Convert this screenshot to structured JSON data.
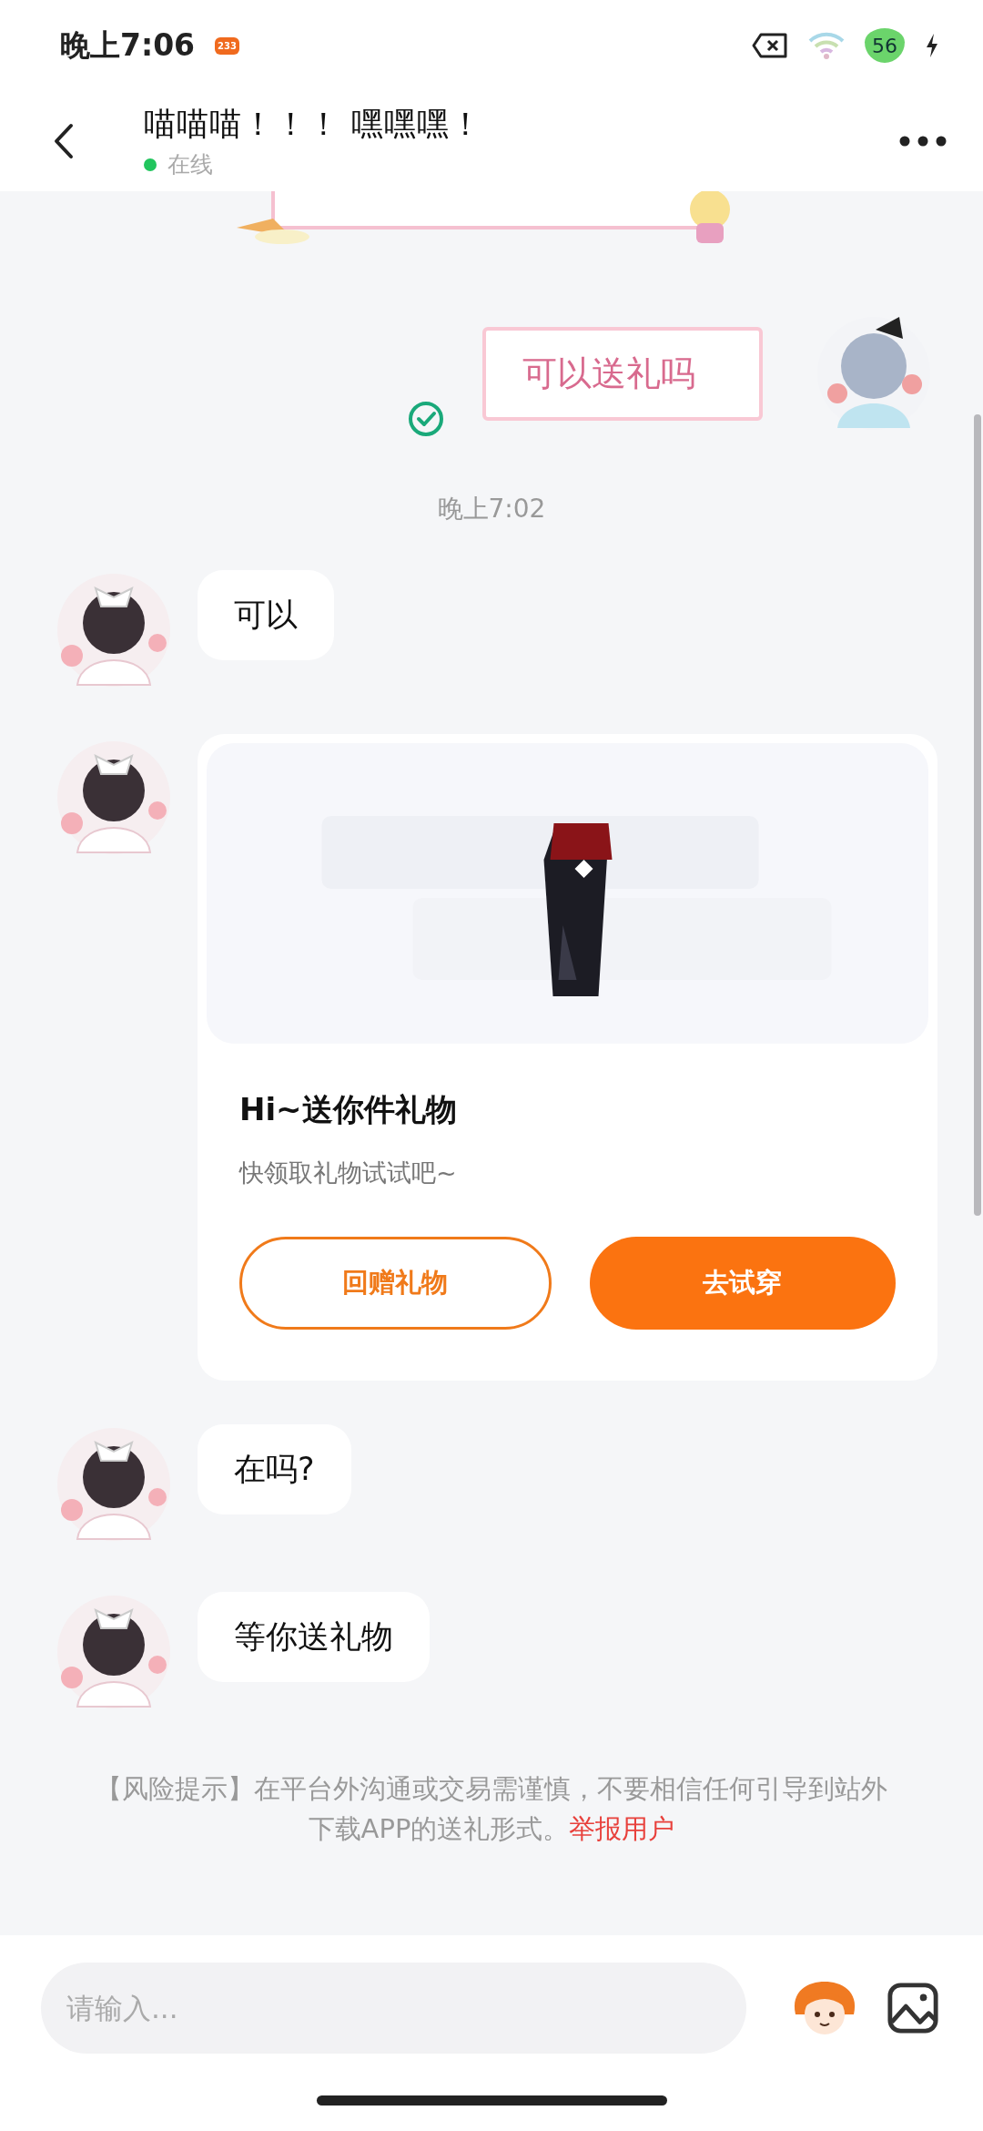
{
  "status_bar": {
    "time": "晚上7:06",
    "app_badge": "233",
    "battery": "56"
  },
  "header": {
    "title": "喵喵喵！！！ 嘿嘿嘿！",
    "status": "在线",
    "online": true
  },
  "messages": [
    {
      "kind": "sticker_text",
      "outgoing": true,
      "text": "可以送礼吗",
      "read": true
    },
    {
      "kind": "time",
      "text": "晚上7:02"
    },
    {
      "kind": "text",
      "outgoing": false,
      "text": "可以"
    },
    {
      "kind": "gift",
      "outgoing": false,
      "title": "Hi~送你件礼物",
      "subtitle": "快领取礼物试试吧~",
      "buttons": [
        {
          "label": "回赠礼物",
          "kind": "outline"
        },
        {
          "label": "去试穿",
          "kind": "filled"
        }
      ]
    },
    {
      "kind": "text",
      "outgoing": false,
      "text": "在吗?"
    },
    {
      "kind": "text",
      "outgoing": false,
      "text": "等你送礼物"
    },
    {
      "kind": "notice",
      "text": "【风险提示】在平台外沟通或交易需谨慎，不要相信任何引导到站外下载APP的送礼形式。",
      "link": "举报用户"
    }
  ],
  "composer": {
    "placeholder": "请输入..."
  }
}
